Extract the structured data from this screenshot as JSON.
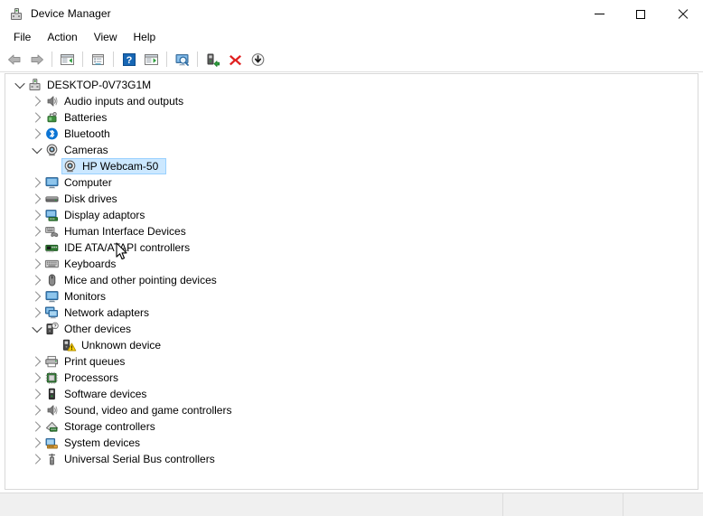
{
  "window": {
    "title": "Device Manager",
    "icon": "device-manager-icon",
    "controls": {
      "minimize": "minimize-button",
      "maximize": "maximize-button",
      "close": "close-button"
    }
  },
  "menubar": {
    "items": [
      {
        "label": "File"
      },
      {
        "label": "Action"
      },
      {
        "label": "View"
      },
      {
        "label": "Help"
      }
    ]
  },
  "toolbar": {
    "buttons": [
      {
        "name": "back-icon",
        "title": "Back"
      },
      {
        "name": "forward-icon",
        "title": "Forward"
      },
      {
        "name": "separator"
      },
      {
        "name": "show-hide-console-tree-icon",
        "title": "Show/Hide Console Tree"
      },
      {
        "name": "separator"
      },
      {
        "name": "properties-icon",
        "title": "Properties"
      },
      {
        "name": "separator"
      },
      {
        "name": "help-icon",
        "title": "Help"
      },
      {
        "name": "update-driver-icon",
        "title": "Update driver"
      },
      {
        "name": "separator"
      },
      {
        "name": "scan-for-hardware-changes-icon",
        "title": "Scan for hardware changes"
      },
      {
        "name": "separator"
      },
      {
        "name": "update-driver-software-icon",
        "title": "Update Driver Software"
      },
      {
        "name": "uninstall-device-icon",
        "title": "Uninstall device"
      },
      {
        "name": "disable-device-icon",
        "title": "Disable device"
      }
    ]
  },
  "tree": {
    "rows": [
      {
        "label": "DESKTOP-0V73G1M",
        "icon": "computer-root-icon",
        "indent": 0,
        "expander": "down",
        "selected": false
      },
      {
        "label": "Audio inputs and outputs",
        "icon": "speaker-icon",
        "indent": 1,
        "expander": "right",
        "selected": false
      },
      {
        "label": "Batteries",
        "icon": "battery-icon",
        "indent": 1,
        "expander": "right",
        "selected": false
      },
      {
        "label": "Bluetooth",
        "icon": "bluetooth-icon",
        "indent": 1,
        "expander": "right",
        "selected": false
      },
      {
        "label": "Cameras",
        "icon": "camera-icon",
        "indent": 1,
        "expander": "down",
        "selected": false
      },
      {
        "label": "HP Webcam-50",
        "icon": "camera-icon",
        "indent": 2,
        "expander": "none",
        "selected": true
      },
      {
        "label": "Computer",
        "icon": "monitor-icon",
        "indent": 1,
        "expander": "right",
        "selected": false
      },
      {
        "label": "Disk drives",
        "icon": "disk-drive-icon",
        "indent": 1,
        "expander": "right",
        "selected": false
      },
      {
        "label": "Display adaptors",
        "icon": "display-adapter-icon",
        "indent": 1,
        "expander": "right",
        "selected": false
      },
      {
        "label": "Human Interface Devices",
        "icon": "hid-icon",
        "indent": 1,
        "expander": "right",
        "selected": false
      },
      {
        "label": "IDE ATA/ATAPI controllers",
        "icon": "ide-controller-icon",
        "indent": 1,
        "expander": "right",
        "selected": false
      },
      {
        "label": "Keyboards",
        "icon": "keyboard-icon",
        "indent": 1,
        "expander": "right",
        "selected": false
      },
      {
        "label": "Mice and other pointing devices",
        "icon": "mouse-icon",
        "indent": 1,
        "expander": "right",
        "selected": false
      },
      {
        "label": "Monitors",
        "icon": "monitor-icon",
        "indent": 1,
        "expander": "right",
        "selected": false
      },
      {
        "label": "Network adapters",
        "icon": "network-adapter-icon",
        "indent": 1,
        "expander": "right",
        "selected": false
      },
      {
        "label": "Other devices",
        "icon": "other-devices-icon",
        "indent": 1,
        "expander": "down",
        "selected": false
      },
      {
        "label": "Unknown device",
        "icon": "unknown-device-warning-icon",
        "indent": 2,
        "expander": "none",
        "selected": false
      },
      {
        "label": "Print queues",
        "icon": "printer-icon",
        "indent": 1,
        "expander": "right",
        "selected": false
      },
      {
        "label": "Processors",
        "icon": "processor-icon",
        "indent": 1,
        "expander": "right",
        "selected": false
      },
      {
        "label": "Software devices",
        "icon": "software-device-icon",
        "indent": 1,
        "expander": "right",
        "selected": false
      },
      {
        "label": "Sound, video and game controllers",
        "icon": "speaker-icon",
        "indent": 1,
        "expander": "right",
        "selected": false
      },
      {
        "label": "Storage controllers",
        "icon": "storage-controller-icon",
        "indent": 1,
        "expander": "right",
        "selected": false
      },
      {
        "label": "System devices",
        "icon": "system-device-icon",
        "indent": 1,
        "expander": "right",
        "selected": false
      },
      {
        "label": "Universal Serial Bus controllers",
        "icon": "usb-icon",
        "indent": 1,
        "expander": "right",
        "selected": false
      }
    ]
  },
  "statusbar": {
    "panes": [
      "",
      "",
      ""
    ]
  },
  "colors": {
    "selection_fill": "#cce8ff",
    "selection_border": "#99d1ff",
    "accent_blue": "#0078d7",
    "warning_yellow": "#ffd400",
    "error_red": "#e81123",
    "window_bg": "#ffffff",
    "statusbar_bg": "#f0f0f0"
  }
}
